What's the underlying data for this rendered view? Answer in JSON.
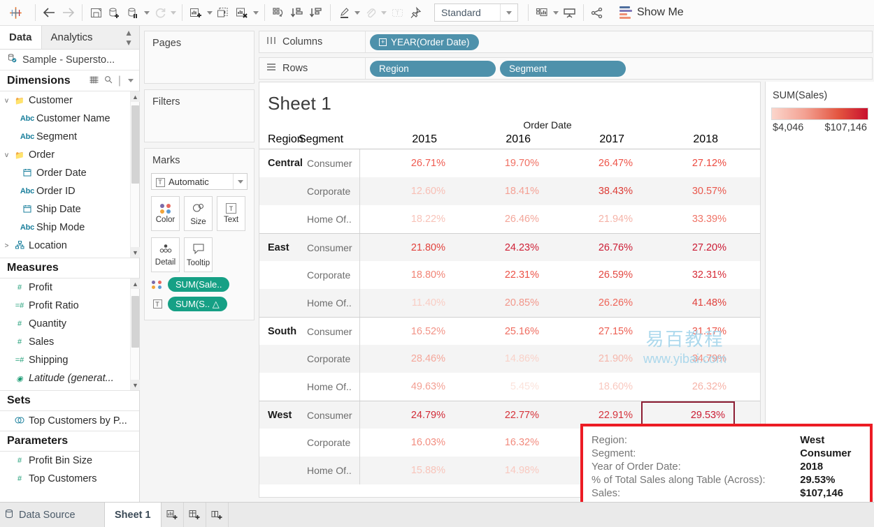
{
  "toolbar": {
    "logo_icon": "tableau-logo-icon",
    "buttons": [
      {
        "name": "back-button",
        "icon": "arrow-left-icon"
      },
      {
        "name": "forward-button",
        "icon": "arrow-right-icon"
      },
      {
        "name": "save-button",
        "icon": "save-icon"
      },
      {
        "name": "new-data-source-button",
        "icon": "database-plus-icon"
      },
      {
        "name": "pause-auto-updates-button",
        "icon": "database-pause-icon"
      },
      {
        "name": "refresh-button",
        "icon": "refresh-icon"
      },
      {
        "name": "new-worksheet-button",
        "icon": "chart-plus-icon"
      },
      {
        "name": "duplicate-sheet-button",
        "icon": "chart-duplicate-icon"
      },
      {
        "name": "clear-sheet-button",
        "icon": "chart-clear-icon"
      },
      {
        "name": "swap-rows-columns-button",
        "icon": "swap-icon"
      },
      {
        "name": "sort-ascending-button",
        "icon": "sort-asc-icon"
      },
      {
        "name": "sort-descending-button",
        "icon": "sort-desc-icon"
      },
      {
        "name": "highlight-button",
        "icon": "highlighter-icon"
      },
      {
        "name": "group-members-button",
        "icon": "paperclip-icon"
      },
      {
        "name": "show-mark-labels-button",
        "icon": "text-label-icon"
      },
      {
        "name": "fix-axes-button",
        "icon": "pushpin-icon"
      }
    ],
    "fit": {
      "label": "Standard",
      "caret_icon": "chevron-down-icon"
    },
    "presentation": {
      "name": "show-hide-cards-button",
      "icon": "cards-icon"
    },
    "slideshow": {
      "name": "presentation-mode-button",
      "icon": "presentation-icon"
    },
    "share": {
      "name": "share-button",
      "icon": "share-icon"
    },
    "show_me": {
      "label": "Show Me",
      "icon": "show-me-icon"
    }
  },
  "left_pane": {
    "tabs": [
      {
        "label": "Data",
        "active": true
      },
      {
        "label": "Analytics",
        "active": false
      }
    ],
    "sort_icon": "sort-toggle-icon",
    "data_source": {
      "label": "Sample - Supersto...",
      "icon": "database-connected-icon"
    },
    "dimensions": {
      "header": "Dimensions",
      "grid_icon": "grid-view-icon",
      "search_icon": "search-icon",
      "menu_icon": "chevron-down-icon",
      "fields": [
        {
          "label": "Customer",
          "type": "folder",
          "level": 1,
          "expander": "v"
        },
        {
          "label": "Customer Name",
          "type": "abc",
          "level": 2
        },
        {
          "label": "Segment",
          "type": "abc",
          "level": 2
        },
        {
          "label": "Order",
          "type": "folder",
          "level": 1,
          "expander": "v"
        },
        {
          "label": "Order Date",
          "type": "date",
          "level": 2
        },
        {
          "label": "Order ID",
          "type": "abc",
          "level": 2
        },
        {
          "label": "Ship Date",
          "type": "date",
          "level": 2
        },
        {
          "label": "Ship Mode",
          "type": "abc",
          "level": 2
        },
        {
          "label": "Location",
          "type": "hierarchy",
          "level": 1,
          "expander": ">"
        }
      ]
    },
    "measures": {
      "header": "Measures",
      "fields": [
        {
          "label": "Profit",
          "type": "num"
        },
        {
          "label": "Profit Ratio",
          "type": "calc"
        },
        {
          "label": "Quantity",
          "type": "num"
        },
        {
          "label": "Sales",
          "type": "num"
        },
        {
          "label": "Shipping",
          "type": "calc"
        },
        {
          "label": "Latitude (generat...",
          "type": "geo",
          "italic": true
        }
      ]
    },
    "sets": {
      "header": "Sets",
      "fields": [
        {
          "label": "Top Customers by P...",
          "type": "set"
        }
      ]
    },
    "parameters": {
      "header": "Parameters",
      "fields": [
        {
          "label": "Profit Bin Size",
          "type": "num"
        },
        {
          "label": "Top Customers",
          "type": "num"
        }
      ]
    }
  },
  "cards": {
    "pages": {
      "title": "Pages"
    },
    "filters": {
      "title": "Filters"
    },
    "marks": {
      "title": "Marks",
      "mark_type": {
        "label": "Automatic",
        "icon": "text-mark-icon",
        "caret_icon": "chevron-down-icon"
      },
      "buttons": [
        {
          "label": "Color",
          "icon": "color-dots-icon"
        },
        {
          "label": "Size",
          "icon": "size-circles-icon"
        },
        {
          "label": "Text",
          "icon": "text-box-icon"
        },
        {
          "label": "Detail",
          "icon": "detail-dots-icon"
        },
        {
          "label": "Tooltip",
          "icon": "tooltip-bubble-icon"
        }
      ],
      "pills": [
        {
          "label": "SUM(Sale..",
          "icon": "color-dots-icon"
        },
        {
          "label": "SUM(S..  △",
          "icon": "text-box-icon"
        }
      ]
    }
  },
  "shelves": {
    "columns": {
      "label": "Columns",
      "icon": "columns-icon",
      "pills": [
        {
          "label": "YEAR(Order Date)",
          "has_plus": true
        }
      ]
    },
    "rows": {
      "label": "Rows",
      "icon": "rows-icon",
      "pills": [
        {
          "label": "Region",
          "has_plus": false
        },
        {
          "label": "Segment",
          "has_plus": false
        }
      ]
    }
  },
  "view": {
    "sheet_title": "Sheet 1"
  },
  "chart_data": {
    "type": "table",
    "title": "Sheet 1",
    "column_group_label": "Order Date",
    "row_headers": [
      "Region",
      "Segment"
    ],
    "categories": [
      "2015",
      "2016",
      "2017",
      "2018"
    ],
    "value_format": "percent",
    "measure_on_color": "SUM(Sales)",
    "color_range": [
      "$4,046",
      "$107,146"
    ],
    "rows": [
      {
        "region": "Central",
        "segment": "Consumer",
        "values": [
          "26.71%",
          "19.70%",
          "26.47%",
          "27.12%"
        ],
        "colors": [
          "#ef5b51",
          "#f07063",
          "#ee5449",
          "#ec4b40"
        ],
        "band": false,
        "group_start": true
      },
      {
        "region": "",
        "segment": "Corporate",
        "values": [
          "12.60%",
          "18.41%",
          "38.43%",
          "30.57%"
        ],
        "colors": [
          "#f8bfb5",
          "#f4a195",
          "#dd3b35",
          "#e9584d"
        ],
        "band": true,
        "group_start": false
      },
      {
        "region": "",
        "segment": "Home Of..",
        "values": [
          "18.22%",
          "26.46%",
          "21.94%",
          "33.39%"
        ],
        "colors": [
          "#f8c3b9",
          "#f3a69a",
          "#f5b3a8",
          "#ef7366"
        ],
        "band": false,
        "group_start": false
      },
      {
        "region": "East",
        "segment": "Consumer",
        "values": [
          "21.80%",
          "24.23%",
          "26.76%",
          "27.20%"
        ],
        "colors": [
          "#e2423d",
          "#cf2137",
          "#cc1c34",
          "#cb1a33"
        ],
        "band": true,
        "group_start": true
      },
      {
        "region": "",
        "segment": "Corporate",
        "values": [
          "18.80%",
          "22.31%",
          "26.59%",
          "32.31%"
        ],
        "colors": [
          "#f18476",
          "#ec5348",
          "#e34740",
          "#d72c38"
        ],
        "band": false,
        "group_start": false
      },
      {
        "region": "",
        "segment": "Home Of..",
        "values": [
          "11.40%",
          "20.85%",
          "26.26%",
          "41.48%"
        ],
        "colors": [
          "#f9cdc4",
          "#f2978b",
          "#ee6559",
          "#e0413c"
        ],
        "band": true,
        "group_start": false
      },
      {
        "region": "South",
        "segment": "Consumer",
        "values": [
          "16.52%",
          "25.16%",
          "27.15%",
          "31.17%"
        ],
        "colors": [
          "#f29387",
          "#ef6d60",
          "#ed6054",
          "#ec584c"
        ],
        "band": false,
        "group_start": true
      },
      {
        "region": "",
        "segment": "Corporate",
        "values": [
          "28.46%",
          "14.86%",
          "21.90%",
          "34.79%"
        ],
        "colors": [
          "#f5a79b",
          "#f9d2c9",
          "#f6b7ac",
          "#f18e81"
        ],
        "band": true,
        "group_start": false
      },
      {
        "region": "",
        "segment": "Home Of..",
        "values": [
          "49.63%",
          "5.45%",
          "18.60%",
          "26.32%"
        ],
        "colors": [
          "#f3a094",
          "#fce3db",
          "#f9c8bf",
          "#f6b3a8"
        ],
        "band": false,
        "group_start": false
      },
      {
        "region": "West",
        "segment": "Consumer",
        "values": [
          "24.79%",
          "22.77%",
          "22.91%",
          "29.53%"
        ],
        "colors": [
          "#d22b37",
          "#d6333a",
          "#d5313a",
          "#cb1c34"
        ],
        "band": true,
        "group_start": true,
        "selected_index": 3
      },
      {
        "region": "",
        "segment": "Corporate",
        "values": [
          "16.03%",
          "16.32%",
          "",
          ""
        ],
        "colors": [
          "#f28d80",
          "#f28b7e",
          "",
          ""
        ],
        "band": false,
        "group_start": false
      },
      {
        "region": "",
        "segment": "Home Of..",
        "values": [
          "15.88%",
          "14.98%",
          "",
          ""
        ],
        "colors": [
          "#f8c4ba",
          "#f9c9c0",
          "",
          ""
        ],
        "band": true,
        "group_start": false
      }
    ]
  },
  "legend": {
    "title": "SUM(Sales)",
    "min": "$4,046",
    "max": "$107,146"
  },
  "tooltip": {
    "rows": [
      {
        "key": "Region:",
        "value": "West"
      },
      {
        "key": "Segment:",
        "value": "Consumer"
      },
      {
        "key": "Year of Order Date:",
        "value": "2018"
      },
      {
        "key": "% of Total Sales along Table (Across):",
        "value": "29.53%"
      },
      {
        "key": "Sales:",
        "value": "$107,146"
      }
    ]
  },
  "watermark": {
    "line1": "易百教程",
    "line2": "www.yibai.com"
  },
  "statusbar": {
    "data_source": {
      "label": "Data Source",
      "icon": "database-icon"
    },
    "tabs": [
      {
        "label": "Sheet 1",
        "active": true
      }
    ],
    "actions": [
      {
        "name": "new-worksheet-tab-button",
        "icon": "new-worksheet-icon"
      },
      {
        "name": "new-dashboard-tab-button",
        "icon": "new-dashboard-icon"
      },
      {
        "name": "new-story-tab-button",
        "icon": "new-story-icon"
      }
    ]
  },
  "colors": {
    "pill_blue": "#4e91ab",
    "pill_green": "#16a085",
    "selection_border": "#8c1d33",
    "tooltip_border": "#ec1c24"
  }
}
